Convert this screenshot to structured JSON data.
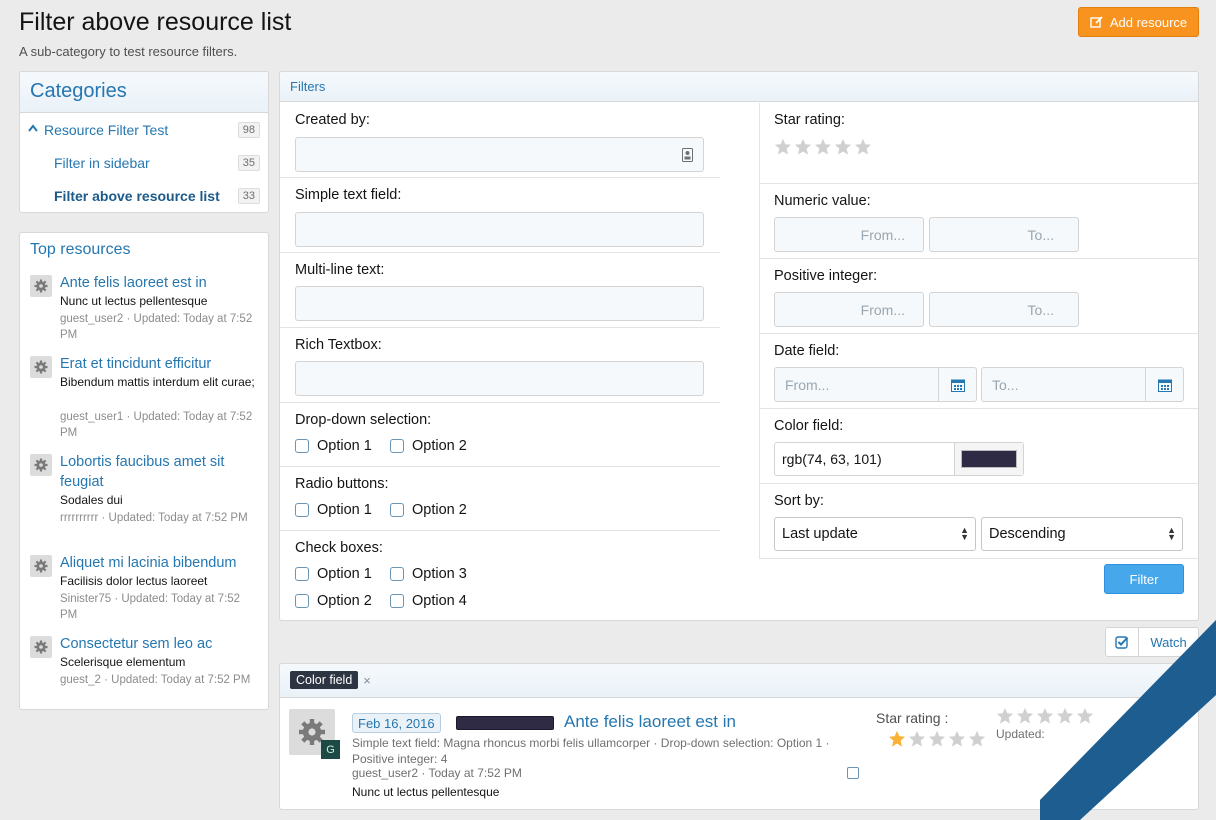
{
  "header": {
    "title": "Filter above resource list",
    "description": "A sub-category to test resource filters.",
    "add_button": "Add resource"
  },
  "categories": {
    "title": "Categories",
    "items": [
      {
        "label": "Resource Filter Test",
        "count": "98"
      },
      {
        "label": "Filter in sidebar",
        "count": "35"
      },
      {
        "label": "Filter above resource list",
        "count": "33"
      }
    ]
  },
  "top_resources": {
    "title": "Top resources",
    "items": [
      {
        "title": "Ante felis laoreet est in",
        "tagline": "Nunc ut lectus pellentesque",
        "meta": "guest_user2 · Updated: Today at 7:52 PM"
      },
      {
        "title": "Erat et tincidunt efficitur",
        "tagline": "Bibendum mattis interdum elit curae;",
        "meta": "guest_user1 · Updated: Today at 7:52 PM"
      },
      {
        "title": "Lobortis faucibus amet sit feugiat",
        "tagline": "Sodales dui",
        "meta": "rrrrrrrrrr · Updated: Today at 7:52 PM"
      },
      {
        "title": "Aliquet mi lacinia bibendum",
        "tagline": "Facilisis dolor lectus laoreet",
        "meta": "Sinister75 · Updated: Today at 7:52 PM"
      },
      {
        "title": "Consectetur sem leo ac",
        "tagline": "Scelerisque elementum",
        "meta": "guest_2 · Updated: Today at 7:52 PM"
      }
    ]
  },
  "filters": {
    "title": "Filters",
    "created_by": {
      "label": "Created by:",
      "value": ""
    },
    "simple_text": {
      "label": "Simple text field:",
      "value": ""
    },
    "multi_line": {
      "label": "Multi-line text:",
      "value": ""
    },
    "rich_text": {
      "label": "Rich Textbox:",
      "value": ""
    },
    "dropdown": {
      "label": "Drop-down selection:",
      "options": [
        "Option 1",
        "Option 2"
      ]
    },
    "radio": {
      "label": "Radio buttons:",
      "options": [
        "Option 1",
        "Option 2"
      ]
    },
    "checkboxes": {
      "label": "Check boxes:",
      "options": [
        "Option 1",
        "Option 3",
        "Option 2",
        "Option 4"
      ]
    },
    "star_rating": {
      "label": "Star rating:",
      "value": 0,
      "max": 5
    },
    "numeric": {
      "label": "Numeric value:",
      "from": "From...",
      "to": "To..."
    },
    "positive_int": {
      "label": "Positive integer:",
      "from": "From...",
      "to": "To..."
    },
    "date": {
      "label": "Date field:",
      "from": "From...",
      "to": "To..."
    },
    "color": {
      "label": "Color field:",
      "value": "rgb(74, 63, 101)",
      "swatch": "#2f2b45"
    },
    "sort": {
      "label": "Sort by:",
      "field": "Last update",
      "direction": "Descending"
    },
    "submit": "Filter"
  },
  "watch": {
    "label": "Watch"
  },
  "list": {
    "active_filter": "Color field",
    "remove": "×",
    "item": {
      "date": "Feb 16, 2016",
      "title": "Ante felis laoreet est in",
      "fields": "Simple text field: Magna rhoncus morbi felis ullamcorper · Drop-down selection: Option 1 · Positive integer: 4",
      "meta": "guest_user2 · Today at 7:52 PM",
      "tagline": "Nunc ut lectus pellentesque",
      "avatar_letter": "G",
      "rating_label": "Star rating :",
      "rating": 1,
      "updated_label": "Updated:"
    }
  },
  "colors": {
    "accent": "#2577b1",
    "orange": "#f7931e",
    "primary_btn": "#47a7eb",
    "star_on": "#f9b233",
    "star_off": "#d0d0d0"
  }
}
